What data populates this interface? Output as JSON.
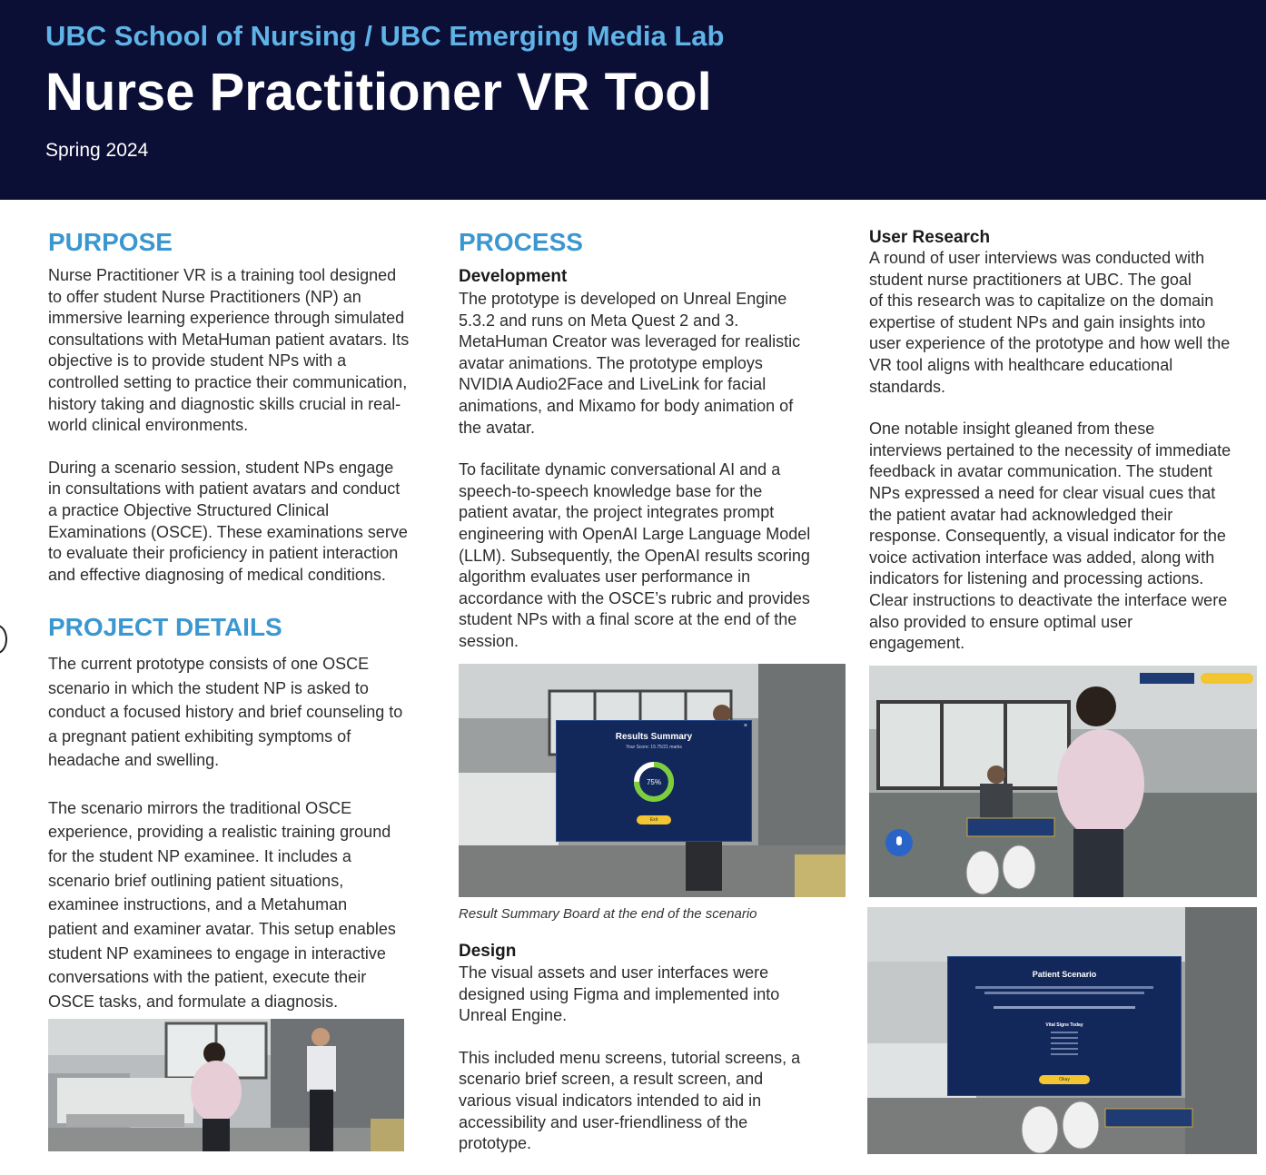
{
  "header": {
    "org": "UBC School of Nursing / UBC Emerging Media Lab",
    "title": "Nurse Practitioner VR Tool",
    "date": "Spring 2024"
  },
  "purpose": {
    "heading": "PURPOSE",
    "p1": [
      "Nurse Practitioner VR is a training tool designed",
      "to offer student Nurse Practitioners (NP) an",
      "immersive learning experience through simulated",
      "consultations with MetaHuman patient avatars. Its",
      "objective is to provide student NPs with a",
      "controlled setting to practice their communication,",
      "history taking and diagnostic skills crucial in real-",
      "world clinical environments."
    ],
    "p2": [
      "During a scenario session, student NPs engage",
      "in consultations with patient avatars and conduct",
      "a practice Objective Structured Clinical",
      "Examinations (OSCE). These examinations serve",
      "to evaluate their proficiency in patient interaction",
      "and effective diagnosing of medical conditions."
    ]
  },
  "project_details": {
    "heading": "PROJECT DETAILS",
    "p1": [
      "The current prototype consists of one OSCE",
      "scenario in which the student NP is asked to",
      "conduct a focused history and brief counseling to",
      "a pregnant patient exhibiting symptoms of",
      "headache and swelling."
    ],
    "p2": [
      "The scenario mirrors the traditional OSCE",
      "experience, providing a realistic training ground",
      "for the student NP examinee. It includes a",
      "scenario brief outlining patient situations,",
      "examinee instructions, and a Metahuman",
      "patient and examiner avatar. This setup enables",
      "student NP examinees to engage in interactive",
      "conversations with the patient, execute their",
      "OSCE tasks, and formulate a diagnosis."
    ]
  },
  "process": {
    "heading": "PROCESS",
    "development": {
      "heading": "Development",
      "p1": [
        "The prototype is developed on Unreal Engine",
        "5.3.2 and runs on Meta Quest 2 and 3.",
        "MetaHuman Creator was leveraged for realistic",
        "avatar animations. The prototype employs",
        "NVIDIA Audio2Face and LiveLink for facial",
        "animations, and Mixamo for body animation of",
        "the avatar."
      ],
      "p2": [
        "To facilitate dynamic conversational AI and a",
        "speech-to-speech knowledge base for the",
        "patient avatar, the project integrates prompt",
        "engineering with OpenAI Large Language Model",
        "(LLM). Subsequently, the OpenAI results scoring",
        "algorithm evaluates user performance in",
        "accordance with the OSCE’s rubric and provides",
        "student NPs with a final score at the end of the",
        "session."
      ]
    },
    "result_screen": {
      "title": "Results Summary",
      "score_line": "Your Score: 15.75/21 marks",
      "percent": "75%",
      "percent_value": 75,
      "button": "Exit",
      "caption": "Result Summary Board at the end of the scenario"
    },
    "design": {
      "heading": "Design",
      "p1": [
        "The visual assets and user interfaces were",
        "designed using Figma and implemented into",
        "Unreal Engine."
      ],
      "p2": [
        "This included menu screens, tutorial screens, a",
        "scenario brief screen, a result screen, and",
        "various visual indicators intended to aid in",
        "accessibility and user-friendliness of the",
        "prototype."
      ]
    }
  },
  "user_research": {
    "heading": "User Research",
    "p1": [
      "A round of user interviews was conducted with",
      "student nurse practitioners at UBC. The goal",
      "of this research was to capitalize on the domain",
      "expertise of student NPs and gain insights into",
      "user experience of the prototype and how well the",
      "VR tool aligns with healthcare educational",
      "standards."
    ],
    "p2": [
      "One notable insight gleaned from these",
      "interviews pertained to the necessity of immediate",
      "feedback in avatar communication. The student",
      "NPs expressed a need for clear visual cues that",
      "the patient avatar had acknowledged their",
      "response. Consequently, a visual indicator for the",
      "voice activation interface was added, along with",
      "indicators for listening and processing actions.",
      "Clear instructions to deactivate the interface were",
      "also provided to ensure optimal user",
      "engagement."
    ],
    "scenario_panel": {
      "title": "Patient Scenario",
      "vitals_heading": "Vital Signs Today",
      "button": "Okay"
    }
  },
  "colors": {
    "header_bg": "#0b0f35",
    "org_blue": "#5fb3e6",
    "heading_blue": "#3b97cf",
    "panel_navy": "#13285a",
    "accent_yellow": "#f2c531",
    "ring_green": "#7ccf3a"
  }
}
